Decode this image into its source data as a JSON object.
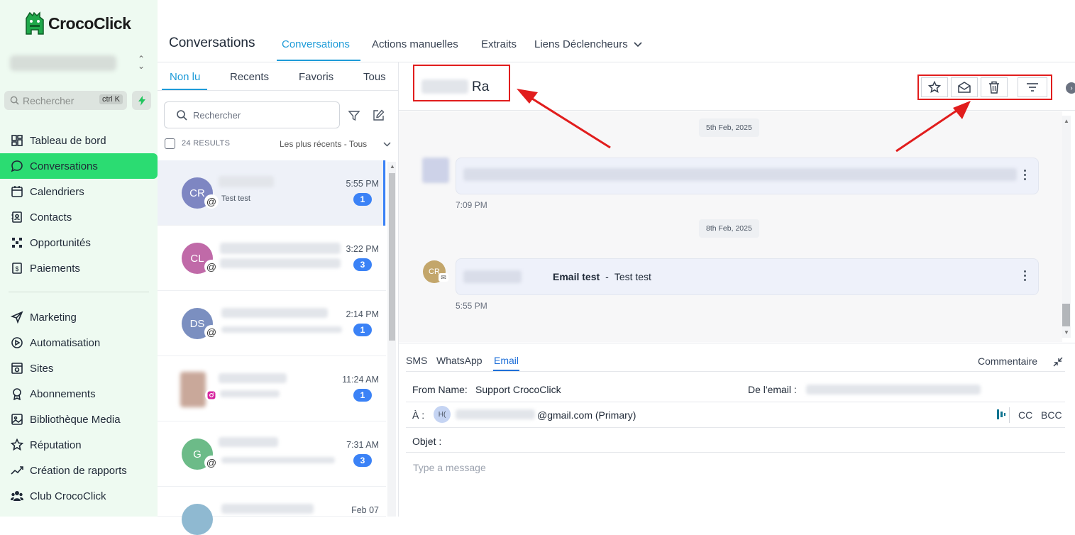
{
  "brand": {
    "name": "CrocoClick"
  },
  "sidebar": {
    "search_placeholder": "Rechercher",
    "search_shortcut": "ctrl K",
    "items": [
      {
        "label": "Tableau de bord",
        "icon": "dashboard-icon"
      },
      {
        "label": "Conversations",
        "icon": "chat-bubble-icon",
        "active": true
      },
      {
        "label": "Calendriers",
        "icon": "calendar-icon"
      },
      {
        "label": "Contacts",
        "icon": "contacts-icon"
      },
      {
        "label": "Opportunités",
        "icon": "pipeline-icon"
      },
      {
        "label": "Paiements",
        "icon": "payment-icon"
      },
      {
        "label": "Marketing",
        "icon": "send-icon"
      },
      {
        "label": "Automatisation",
        "icon": "automation-icon"
      },
      {
        "label": "Sites",
        "icon": "sites-icon"
      },
      {
        "label": "Abonnements",
        "icon": "membership-icon"
      },
      {
        "label": "Bibliothèque Media",
        "icon": "media-icon"
      },
      {
        "label": "Réputation",
        "icon": "star-icon"
      },
      {
        "label": "Création de rapports",
        "icon": "report-icon"
      },
      {
        "label": "Club CrocoClick",
        "icon": "community-icon"
      }
    ]
  },
  "header": {
    "title": "Conversations",
    "tabs": [
      {
        "label": "Conversations",
        "active": true
      },
      {
        "label": "Actions manuelles"
      },
      {
        "label": "Extraits"
      },
      {
        "label": "Liens Déclencheurs"
      }
    ]
  },
  "list": {
    "tabs": [
      {
        "label": "Non lu",
        "active": true
      },
      {
        "label": "Recents"
      },
      {
        "label": "Favoris"
      },
      {
        "label": "Tous"
      }
    ],
    "search_placeholder": "Rechercher",
    "results": "24 RESULTS",
    "sort": "Les plus récents - Tous",
    "conversations": [
      {
        "initials": "CR",
        "color": "#7e86c2",
        "time": "5:55 PM",
        "unread": "1",
        "snippet": "Test test",
        "channel": "email"
      },
      {
        "initials": "CL",
        "color": "#c06aa8",
        "time": "3:22 PM",
        "unread": "3",
        "snippet": "",
        "channel": "email"
      },
      {
        "initials": "DS",
        "color": "#7b8fc0",
        "time": "2:14 PM",
        "unread": "1",
        "snippet": "",
        "channel": "email"
      },
      {
        "initials": "",
        "color": "#c9a89a",
        "time": "11:24 AM",
        "unread": "1",
        "snippet": "",
        "channel": "instagram"
      },
      {
        "initials": "G",
        "color": "#6cbb88",
        "time": "7:31 AM",
        "unread": "3",
        "snippet": "",
        "channel": "email"
      },
      {
        "initials": "",
        "color": "#8fb9d1",
        "time": "Feb 07",
        "unread": "",
        "snippet": "",
        "channel": "email"
      }
    ]
  },
  "thread": {
    "contact_name_suffix": "Ra",
    "actions": [
      "star-icon",
      "mark-unread-icon",
      "trash-icon",
      "filter-icon"
    ],
    "messages": [
      {
        "date": "5th Feb, 2025",
        "time": "7:09 PM",
        "text": ""
      },
      {
        "date": "8th Feb, 2025",
        "time": "5:55 PM",
        "avatar": "CR",
        "subject": "Email test",
        "separator": "-",
        "body": "Test test"
      }
    ]
  },
  "composer": {
    "tabs": [
      {
        "label": "SMS"
      },
      {
        "label": "WhatsApp"
      },
      {
        "label": "Email",
        "active": true
      }
    ],
    "comment_label": "Commentaire",
    "from_name_label": "From Name:",
    "from_name_value": "Support CrocoClick",
    "from_email_label": "De l'email :",
    "to_label": "À :",
    "to_chip": "H(",
    "to_value": "@gmail.com (Primary)",
    "cc": "CC",
    "bcc": "BCC",
    "subject_label": "Objet :",
    "message_placeholder": "Type a message"
  },
  "colors": {
    "accent": "#1e9bd8",
    "active_nav": "#2bdc72",
    "badge": "#3b82f6",
    "annotation": "#e11d1d"
  }
}
